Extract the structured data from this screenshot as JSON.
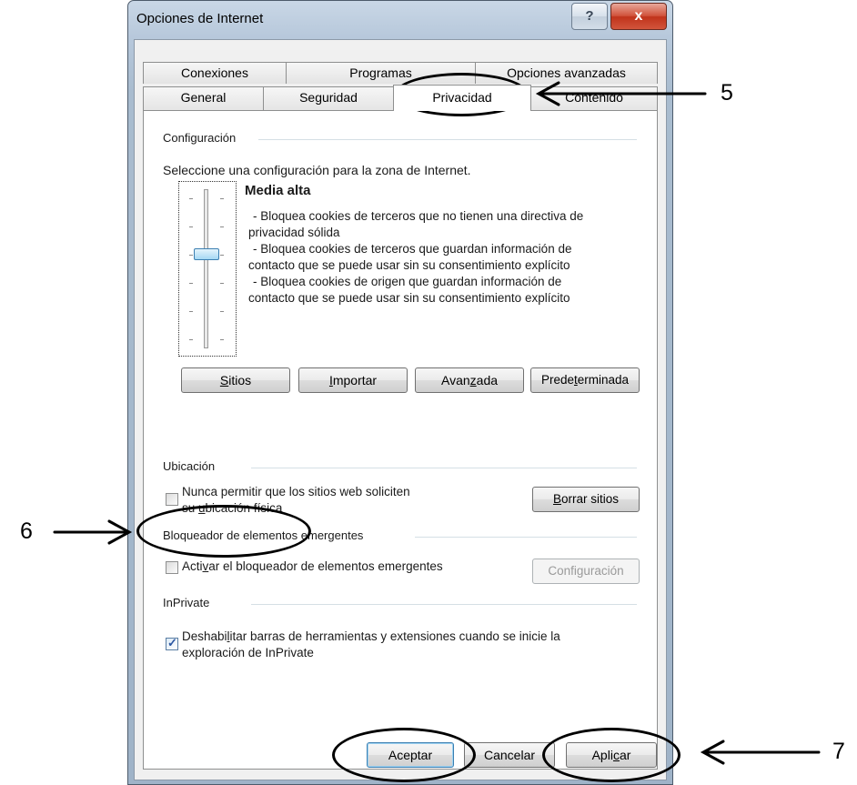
{
  "window": {
    "title": "Opciones de Internet",
    "help_glyph": "?",
    "close_glyph": "x"
  },
  "tabs": {
    "row_back": [
      "Conexiones",
      "Programas",
      "Opciones avanzadas"
    ],
    "row_front": [
      "General",
      "Seguridad",
      "Privacidad",
      "Contenido"
    ],
    "active": "Privacidad"
  },
  "privacy": {
    "config_title": "Configuración",
    "config_instruction": "Seleccione una configuración para la zona de Internet.",
    "level_name": "Media alta",
    "level_fraction": 0.6,
    "level_lines": [
      "- Bloquea cookies de terceros que no tienen una directiva de",
      "privacidad sólida",
      "- Bloquea cookies de terceros que guardan información de",
      "contacto que se puede usar sin su consentimiento explícito",
      "- Bloquea cookies de origen que guardan información de",
      "contacto que se  puede usar sin su consentimiento explícito"
    ],
    "buttons": {
      "sites": {
        "pre": "",
        "key": "S",
        "post": "itios"
      },
      "import": {
        "pre": "",
        "key": "I",
        "post": "mportar"
      },
      "advanced": {
        "pre": "Avan",
        "key": "z",
        "post": "ada"
      },
      "default": {
        "pre": "Prede",
        "key": "t",
        "post": "erminada"
      }
    }
  },
  "location": {
    "title": "Ubicación",
    "never_allow": {
      "line1": "Nunca permitir que los sitios web soliciten",
      "line2_pre": "su ",
      "line2_key": "u",
      "line2_post": "bicación física",
      "checked": false
    },
    "clear_sites": {
      "pre": "",
      "key": "B",
      "post": "orrar sitios"
    }
  },
  "popup": {
    "title": "Bloqueador de elementos emergentes",
    "enable": {
      "pre": "Acti",
      "key": "v",
      "post": "ar el bloqueador de elementos emergentes",
      "checked": false
    },
    "settings": {
      "pre": "Confi",
      "key": "g",
      "post": "uración",
      "enabled": false
    }
  },
  "inprivate": {
    "title": "InPrivate",
    "disable_toolbars": {
      "pre": "Deshabi",
      "key": "l",
      "post": "itar barras de herramientas y extensiones cuando se inicie la",
      "line2": "exploración de InPrivate",
      "checked": true
    }
  },
  "footer": {
    "accept": "Aceptar",
    "cancel": "Cancelar",
    "apply": {
      "pre": "Apli",
      "key": "c",
      "post": "ar"
    }
  },
  "annotations": {
    "five": "5",
    "six": "6",
    "seven": "7"
  }
}
